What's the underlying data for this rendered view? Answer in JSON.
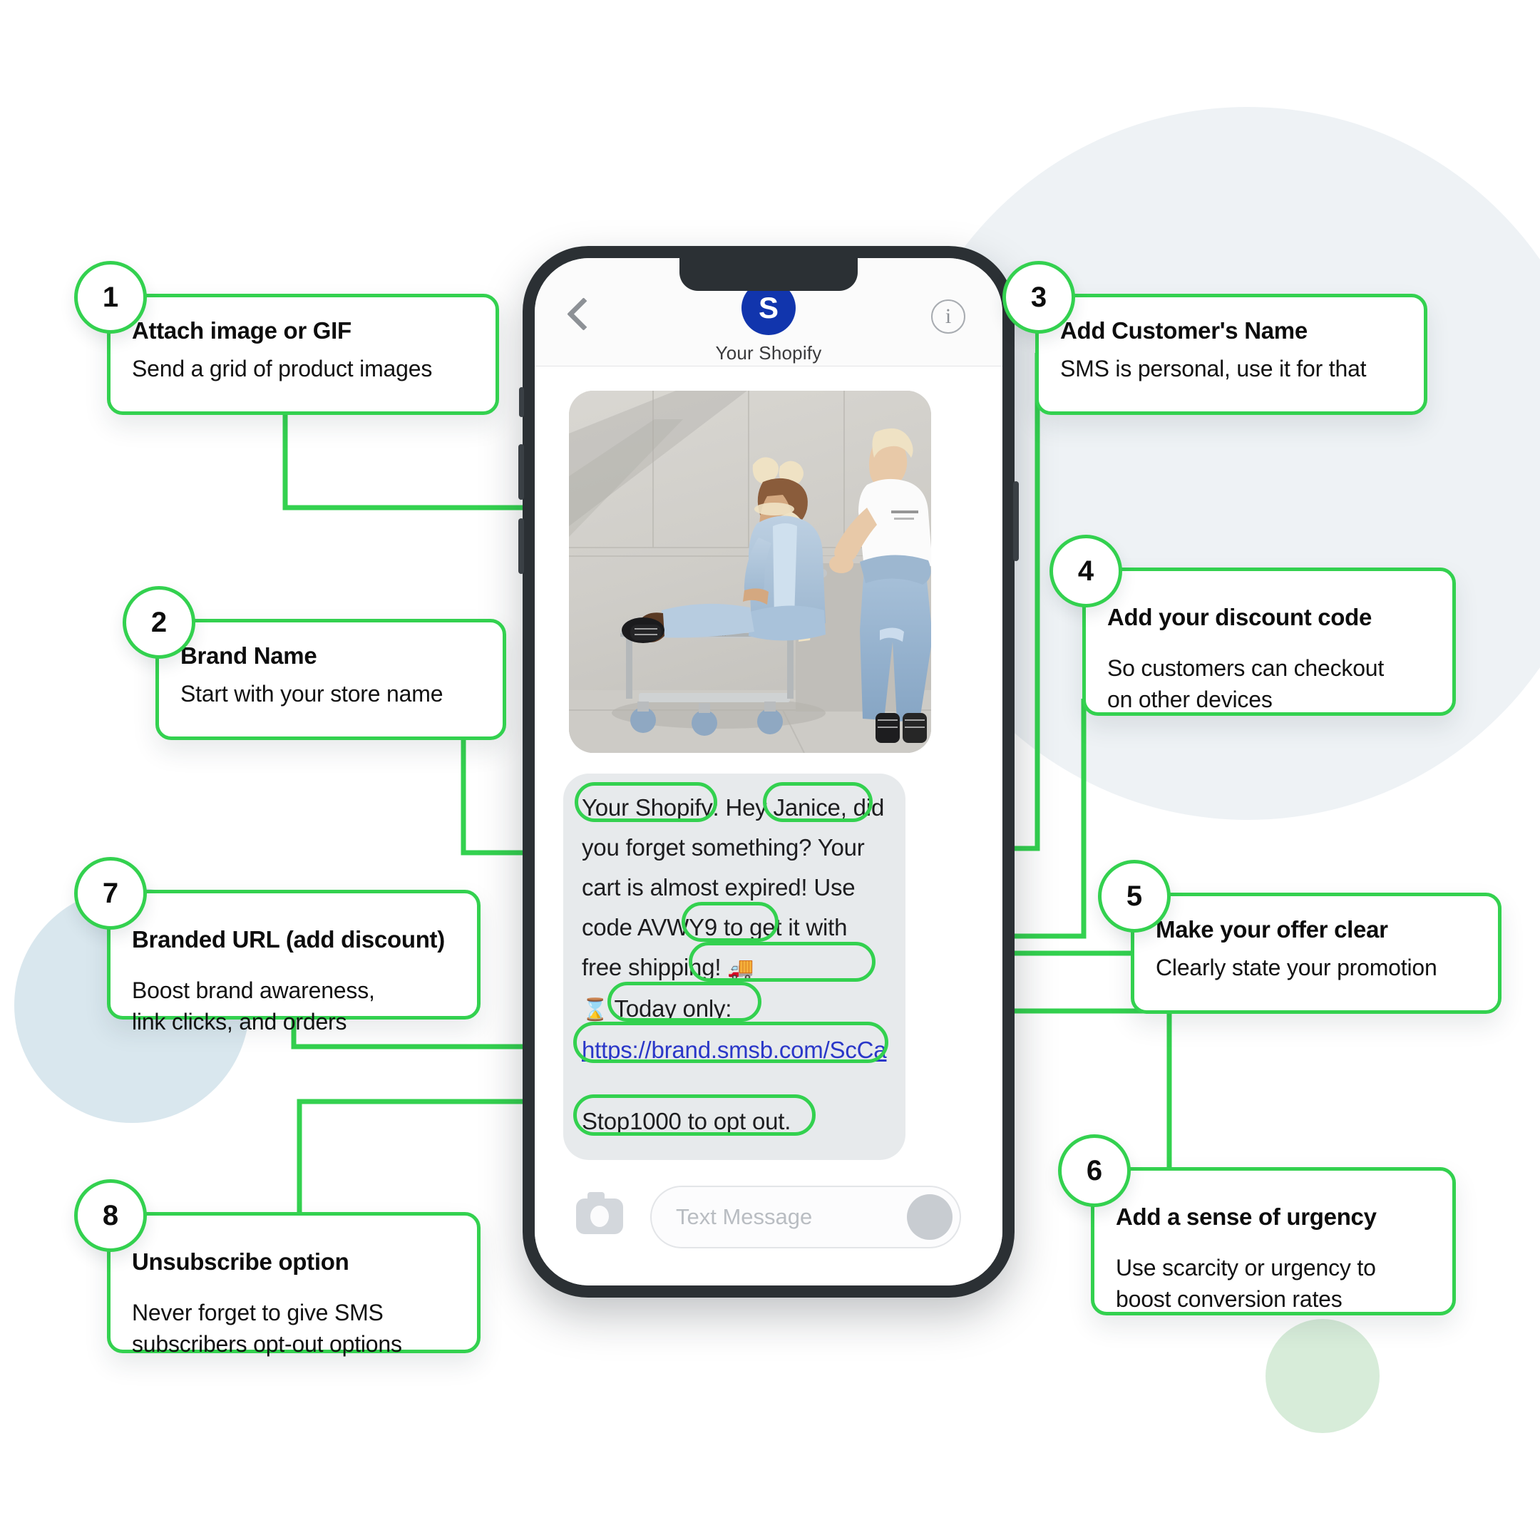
{
  "theme": {
    "accent_green": "#33d14f",
    "phone_frame": "#2b3034",
    "bubble_grey": "#e7eaec",
    "avatar_blue": "#1135ad",
    "link_blue": "#2a37c8",
    "blob_grey": "#eef2f5",
    "blob_blue": "#d9e7ee",
    "blob_green": "#d7ecd9"
  },
  "phone": {
    "header": {
      "back_icon": "chevron-left-icon",
      "avatar_letter": "S",
      "contact_name": "Your Shopify",
      "info_icon": "info-icon"
    },
    "attachment": {
      "alt": "Two models in denim posing with a warehouse cart against a concrete wall"
    },
    "message": {
      "brand_prefix": "Your Shopify:",
      "greeting_lead": "Hey",
      "customer_name": "Janice,",
      "line_2": "did you forget something?",
      "line_3": "Your cart is almost expired!",
      "line_4_lead": "Use code",
      "discount_code": "AVWY9",
      "line_4_tail": "to",
      "line_5_lead": "get it with",
      "offer": "free shipping!",
      "truck_emoji": "🚚",
      "hourglass_emoji": "⌛",
      "urgency": "Today only:",
      "link": "https://brand.smsb.com/ScCa",
      "optout": "Stop1000 to opt out."
    },
    "input_bar": {
      "camera_icon": "camera-icon",
      "placeholder": "Text Message",
      "send_icon": "send-knob-icon"
    }
  },
  "callouts": [
    {
      "number": "1",
      "title": "Attach image or GIF",
      "desc": "Send a grid of product images"
    },
    {
      "number": "2",
      "title": "Brand Name",
      "desc": "Start with your store name"
    },
    {
      "number": "3",
      "title": "Add Customer's Name",
      "desc": "SMS is personal, use it for that"
    },
    {
      "number": "4",
      "title": "Add your discount code",
      "desc": "So customers can checkout\non other devices"
    },
    {
      "number": "5",
      "title": "Make your offer clear",
      "desc": "Clearly state your promotion"
    },
    {
      "number": "6",
      "title": "Add a sense of urgency",
      "desc": "Use scarcity or urgency to\nboost conversion rates"
    },
    {
      "number": "7",
      "title": "Branded URL (add discount)",
      "desc": "Boost brand awareness,\nlink clicks, and orders"
    },
    {
      "number": "8",
      "title": "Unsubscribe option",
      "desc": "Never forget to give SMS\nsubscribers opt-out options"
    }
  ]
}
